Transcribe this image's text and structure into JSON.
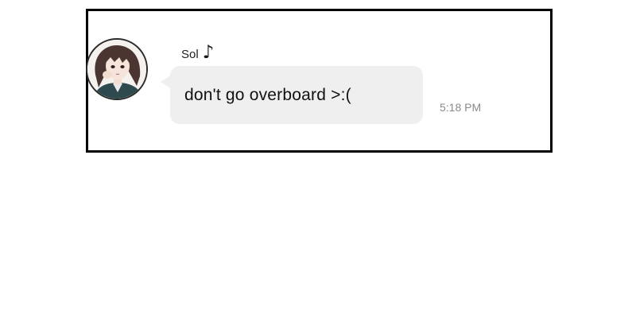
{
  "chat": {
    "sender": {
      "name": "Sol",
      "name_icon": "music-note-icon",
      "name_icon_glyph": "♪",
      "avatar": "avatar"
    },
    "message": {
      "text": "don't go overboard >:(",
      "time": "5:18 PM"
    }
  }
}
